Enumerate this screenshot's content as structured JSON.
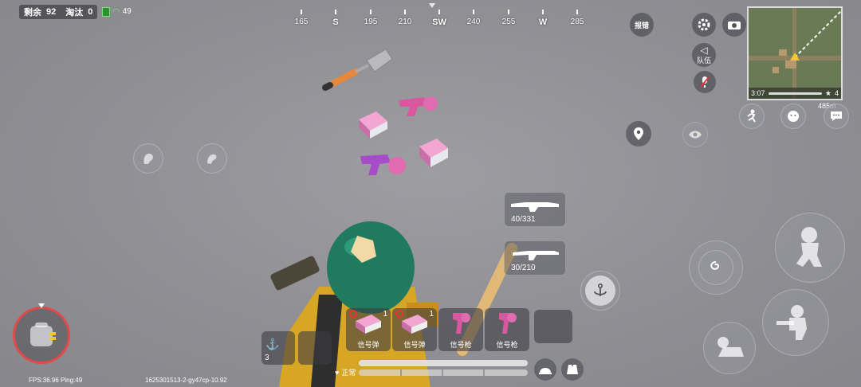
{
  "hud": {
    "remaining_label": "剩余",
    "remaining_count": "92",
    "eliminated_label": "淘汰",
    "eliminated_count": "0",
    "ping_value": "49"
  },
  "compass": {
    "ticks": [
      {
        "label": "165",
        "cardinal": false
      },
      {
        "label": "S",
        "cardinal": true
      },
      {
        "label": "195",
        "cardinal": false
      },
      {
        "label": "210",
        "cardinal": false
      },
      {
        "label": "SW",
        "cardinal": true
      },
      {
        "label": "240",
        "cardinal": false
      },
      {
        "label": "255",
        "cardinal": false
      },
      {
        "label": "W",
        "cardinal": true
      },
      {
        "label": "285",
        "cardinal": false
      }
    ]
  },
  "buttons": {
    "report": "报错",
    "team_voice": "队伍"
  },
  "minimap": {
    "time": "3:07",
    "distance": "485m",
    "team_number": "4"
  },
  "weapons": [
    {
      "ammo": "40/331"
    },
    {
      "ammo": "30/210"
    }
  ],
  "quick_items": [
    {
      "label": "信号弹",
      "count": "1",
      "icon": "flare-box-icon"
    },
    {
      "label": "信号弹",
      "count": "1",
      "icon": "flare-box-icon"
    },
    {
      "label": "信号枪",
      "count": "",
      "icon": "flare-gun-icon"
    },
    {
      "label": "信号枪",
      "count": "",
      "icon": "flare-gun-icon"
    }
  ],
  "anchor_count": "3",
  "health_status": "正常",
  "footer": {
    "fps": "FPS:36.96 Ping:49",
    "build": "1625301513-2-gy47cp-10.92"
  },
  "colors": {
    "accent_green": "#7ee27e",
    "helmet_green": "#1f7a5e",
    "flare_pink": "#e06bb0",
    "hud_dark": "#3c3c44"
  }
}
